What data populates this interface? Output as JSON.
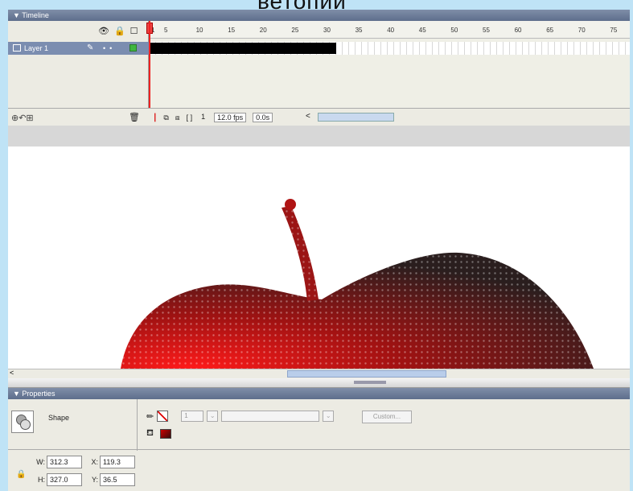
{
  "page": {
    "cut_title": "ветопии"
  },
  "timeline": {
    "title": "Timeline",
    "ruler_labels": [
      "1",
      "5",
      "10",
      "15",
      "20",
      "25",
      "30",
      "35",
      "40",
      "45",
      "50",
      "55",
      "60",
      "65",
      "70",
      "75"
    ],
    "layer_name": "Layer 1",
    "current_frame": "1",
    "fps": "12.0 fps",
    "elapsed": "0.0s"
  },
  "properties": {
    "title": "Properties",
    "type_label": "Shape",
    "stroke_height": "1",
    "custom_label": "Custom...",
    "w_label": "W:",
    "w_value": "312.3",
    "h_label": "H:",
    "h_value": "327.0",
    "x_label": "X:",
    "x_value": "119.3",
    "y_label": "Y:",
    "y_value": "36.5"
  },
  "colors": {
    "fill_start": "#ff2222",
    "fill_end": "#2a1e1e",
    "panel_header": "#6d7d9b",
    "stage_bg": "#ffffff"
  },
  "icons": [
    "eye-icon",
    "lock-icon",
    "outline-icon",
    "layer-icon",
    "pencil-icon",
    "trash-icon",
    "pen-icon",
    "bucket-icon"
  ]
}
